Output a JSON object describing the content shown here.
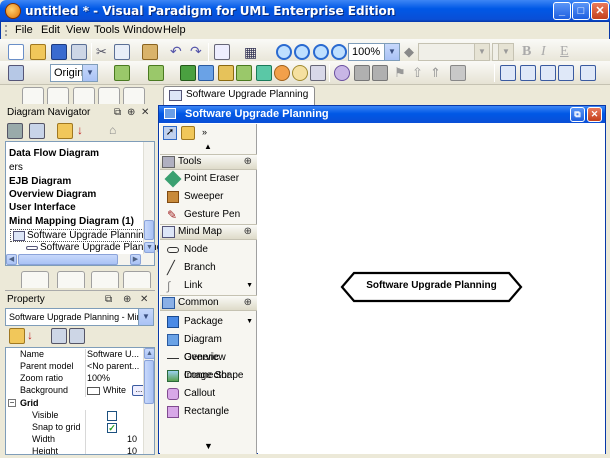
{
  "window": {
    "title": "untitled * - Visual Paradigm for UML Enterprise Edition"
  },
  "menu": [
    "File",
    "Edit",
    "View",
    "Tools",
    "Window",
    "Help"
  ],
  "toolbar": {
    "zoom_value": "100%",
    "style_combo": "Original",
    "font_buttons": {
      "bold": "B",
      "italic": "I",
      "underline": "E"
    }
  },
  "doc_tab": {
    "label": "Software Upgrade Planning"
  },
  "diagram_navigator": {
    "title": "Diagram Navigator",
    "items": [
      {
        "label": "Data Flow Diagram",
        "bold": true
      },
      {
        "label": "ers",
        "bold": false
      },
      {
        "label": "EJB Diagram",
        "bold": true
      },
      {
        "label": "Overview Diagram",
        "bold": true
      },
      {
        "label": "User Interface",
        "bold": true
      },
      {
        "label": "Mind Mapping Diagram (1)",
        "bold": true
      },
      {
        "label": "Software Upgrade Planning",
        "bold": false
      },
      {
        "label": "Software Upgrade Planning",
        "bold": false
      }
    ]
  },
  "property": {
    "title": "Property",
    "selector": "Software Upgrade Planning - Min...",
    "rows": [
      {
        "name": "Name",
        "value": "Software U..."
      },
      {
        "name": "Parent model",
        "value": "<No parent..."
      },
      {
        "name": "Zoom ratio",
        "value": "100%"
      },
      {
        "name": "Background",
        "value": "White"
      }
    ],
    "grid_group": "Grid",
    "grid_rows": [
      {
        "name": "Visible",
        "value": ""
      },
      {
        "name": "Snap to grid",
        "value": ""
      },
      {
        "name": "Width",
        "value": "10"
      },
      {
        "name": "Height",
        "value": "10"
      }
    ],
    "snap_checked": true,
    "visible_checked": false
  },
  "diagram": {
    "title": "Software Upgrade Planning",
    "central_topic": "Software Upgrade Planning"
  },
  "palette": {
    "categories": [
      {
        "label": "Tools",
        "items": [
          "Point Eraser",
          "Sweeper",
          "Gesture Pen"
        ]
      },
      {
        "label": "Mind Map",
        "items": [
          "Node",
          "Branch",
          "Link"
        ]
      },
      {
        "label": "Common",
        "items": [
          "Package",
          "Diagram Overview",
          "Generic Connector",
          "Image Shape",
          "Callout",
          "Rectangle"
        ]
      }
    ]
  },
  "colors": {
    "title_blue": "#0058e6",
    "close_red": "#c4401c",
    "panel_border": "#7f9db9"
  }
}
